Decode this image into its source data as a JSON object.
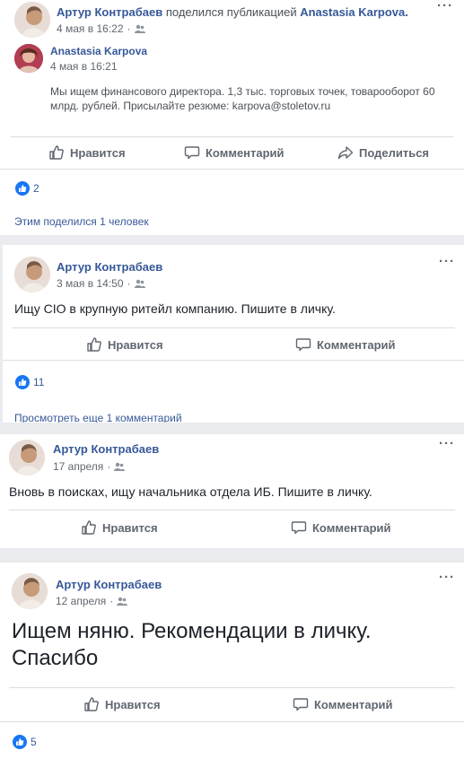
{
  "posts": [
    {
      "author": "Артур Контрабаев",
      "action_text": "поделился публикацией",
      "shared_author": "Anastasia Karpova.",
      "date": "4 мая в 16:22",
      "shared": {
        "author": "Anastasia Karpova",
        "date": "4 мая в 16:21",
        "text": "Мы ищем финансового директора. 1,3 тыс. торговых точек, товарооборот 60 млрд. рублей. Присылайте резюме: karpova@stoletov.ru"
      },
      "actions": {
        "like": "Нравится",
        "comment": "Комментарий",
        "share": "Поделиться"
      },
      "likes": "2",
      "footer": "Этим поделился 1 человек"
    },
    {
      "author": "Артур Контрабаев",
      "date": "3 мая в 14:50",
      "text": "Ищу CIO в крупную ритейл компанию. Пишите в личку.",
      "actions": {
        "like": "Нравится",
        "comment": "Комментарий"
      },
      "likes": "11",
      "footer": "Просмотреть еще 1 комментарий"
    },
    {
      "author": "Артур Контрабаев",
      "date": "17 апреля",
      "text": "Вновь в поисках, ищу начальника отдела ИБ. Пишите в личку.",
      "actions": {
        "like": "Нравится",
        "comment": "Комментарий"
      }
    },
    {
      "author": "Артур Контрабаев",
      "date": "12 апреля",
      "text": "Ищем няню. Рекомендации в личку. Спасибо",
      "actions": {
        "like": "Нравится",
        "comment": "Комментарий"
      },
      "likes": "5"
    }
  ],
  "icons": {
    "more": "ellipsis-icon",
    "friends": "friends-audience-icon",
    "like": "thumbs-up-icon",
    "comment": "comment-bubble-icon",
    "share": "share-arrow-icon"
  },
  "colors": {
    "link": "#365899",
    "like_blue": "#1877f2",
    "background": "#e9ebee"
  }
}
